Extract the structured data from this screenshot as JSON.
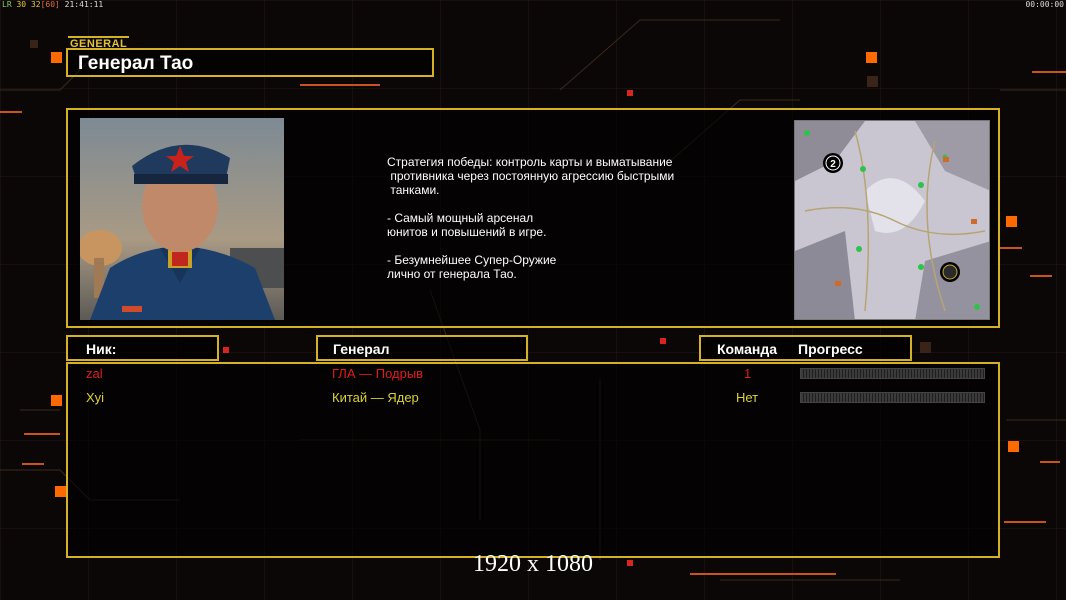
{
  "status_bar": {
    "fps_a": "LR",
    "fps_b": "30",
    "fps_c": "32",
    "fps_d": "[60]",
    "clock": "21:41:11",
    "timer": "00:00:00"
  },
  "general_tag": "GENERAL",
  "general_name": "Генерал Тао",
  "description": "Стратегия победы: контроль карты и выматывание\n противника через постоянную агрессию быстрыми\n танками.\n\n- Самый мощный арсенал\nюнитов и повышений в игре.\n\n- Безумнейшее Супер-Оружие\nлично от генерала Тао.",
  "minimap": {
    "start_marker": "2"
  },
  "columns": {
    "nick": "Ник:",
    "general": "Генерал",
    "team": "Команда",
    "progress": "Прогресс"
  },
  "players": [
    {
      "nick": "zal",
      "general": "ГЛА — Подрыв",
      "team": "1",
      "color": "#e01c1c"
    },
    {
      "nick": "Xyi",
      "general": "Китай — Ядер",
      "team": "Нет",
      "color": "#d9d23a"
    }
  ],
  "resolution_label": "1920 x 1080",
  "colors": {
    "frame": "#d4b224",
    "accent_orange": "#ff6a00",
    "background": "#0b0706"
  }
}
